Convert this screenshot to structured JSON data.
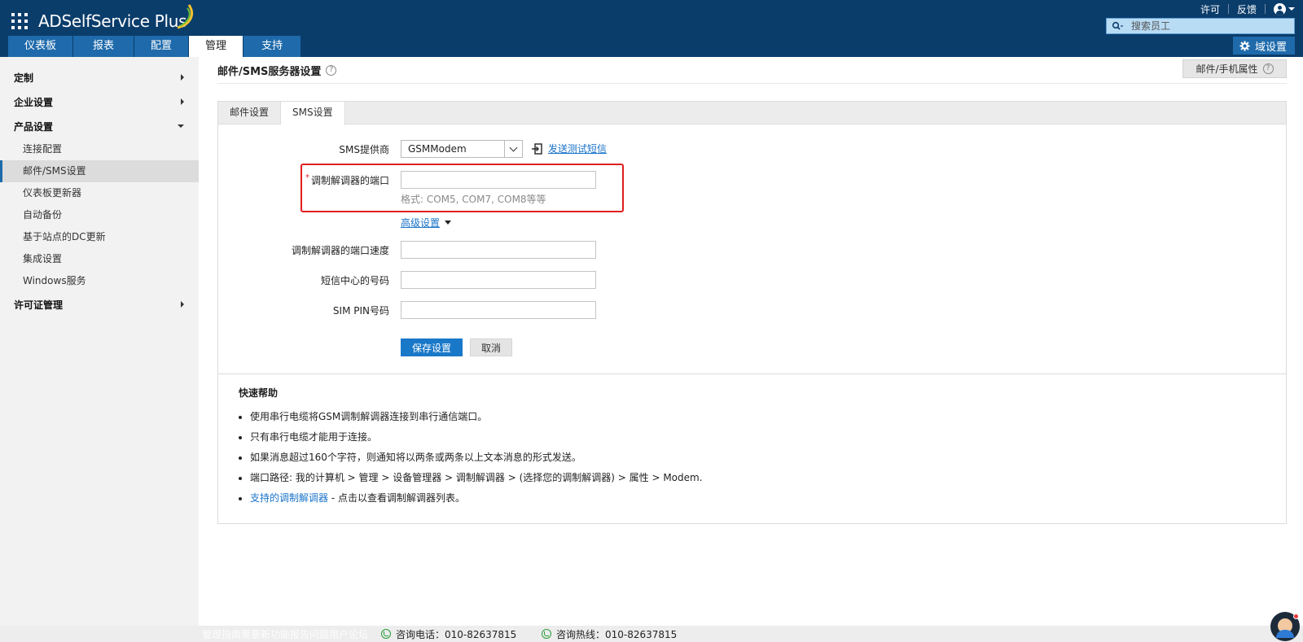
{
  "app": {
    "name": "ADSelfService Plus",
    "brand_color": "#0b3d6b",
    "accent_color": "#1e6aab"
  },
  "top_links": {
    "license": "许可",
    "feedback": "反馈"
  },
  "search": {
    "placeholder": "搜索员工"
  },
  "nav": {
    "tabs": [
      "仪表板",
      "报表",
      "配置",
      "管理",
      "支持"
    ],
    "active": "管理",
    "domain_settings": "域设置"
  },
  "sidebar": {
    "groups": [
      {
        "label": "定制",
        "expanded": false
      },
      {
        "label": "企业设置",
        "expanded": false
      },
      {
        "label": "产品设置",
        "expanded": true
      },
      {
        "label": "许可证管理",
        "expanded": false
      }
    ],
    "items": [
      "连接配置",
      "邮件/SMS设置",
      "仪表板更新器",
      "自动备份",
      "基于站点的DC更新",
      "集成设置",
      "Windows服务"
    ],
    "active_item": "邮件/SMS设置"
  },
  "page": {
    "title": "邮件/SMS服务器设置",
    "properties_button": "邮件/手机属性"
  },
  "panel_tabs": [
    "邮件设置",
    "SMS设置"
  ],
  "active_panel_tab": "SMS设置",
  "form": {
    "sms_provider_label": "SMS提供商",
    "sms_provider_value": "GSMModem",
    "send_test_sms": "发送测试短信",
    "modem_port_label": "调制解调器的端口",
    "modem_port_value": "",
    "modem_port_hint": "格式: COM5, COM7, COM8等等",
    "advanced_settings": "高级设置",
    "port_speed_label": "调制解调器的端口速度",
    "port_speed_value": "",
    "sms_center_label": "短信中心的号码",
    "sms_center_value": "",
    "sim_pin_label": "SIM PIN号码",
    "sim_pin_value": "",
    "save_button": "保存设置",
    "cancel_button": "取消"
  },
  "quick_help": {
    "title": "快速帮助",
    "items": [
      "使用串行电缆将GSM调制解调器连接到串行通信端口。",
      "只有串行电缆才能用于连接。",
      "如果消息超过160个字符，则通知将以两条或两条以上文本消息的形式发送。",
      "端口路径: 我的计算机 > 管理 > 设备管理器 > 调制解调器 > (选择您的调制解调器) > 属性 > Modem."
    ],
    "supported_link": "支持的调制解调器",
    "supported_suffix": " - 点击以查看调制解调器列表。"
  },
  "footer": {
    "links": "管理指南需要新功能报告问题用户论坛",
    "phone": "咨询电话：010-82637815",
    "hotline": "咨询热线：010-82637815"
  }
}
